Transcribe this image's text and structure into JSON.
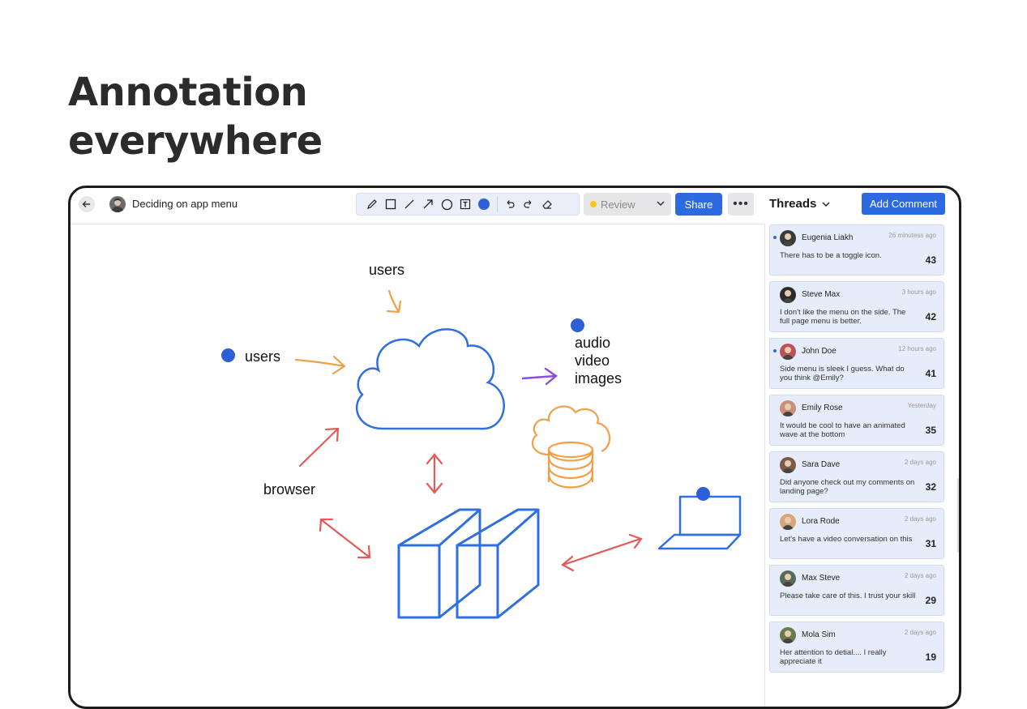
{
  "hero": {
    "line1": "Annotation",
    "line2": "everywhere"
  },
  "document": {
    "title": "Deciding on app menu"
  },
  "toolbar": {
    "tools": [
      "pencil-icon",
      "square-icon",
      "line-icon",
      "arrow-icon",
      "circle-icon",
      "text-icon"
    ],
    "active_color": "#2d5fd8"
  },
  "status": {
    "value": "Review",
    "color": "#f5c518"
  },
  "actions": {
    "share_label": "Share",
    "more_label": "•••"
  },
  "threads": {
    "header": "Threads",
    "add_comment_label": "Add Comment",
    "items": [
      {
        "name": "Eugenia Liakh",
        "time": "26 minutess ago",
        "message": "There has to be a toggle icon.",
        "count": "43",
        "unread": true,
        "avatar": "#3a3a3a"
      },
      {
        "name": "Steve Max",
        "time": "3 hours ago",
        "message": "I don't like the menu on the side. The full page menu is better.",
        "count": "42",
        "unread": false,
        "avatar": "#2b2b2b"
      },
      {
        "name": "John Doe",
        "time": "12 hours ago",
        "message": "Side menu is sleek I guess. What do you think @Emily?",
        "count": "41",
        "unread": true,
        "avatar": "#b8545a"
      },
      {
        "name": "Emily Rose",
        "time": "Yesterday",
        "message": "It would be cool to have an animated wave at the bottom",
        "count": "35",
        "unread": false,
        "avatar": "#c9907a"
      },
      {
        "name": "Sara Dave",
        "time": "2 days ago",
        "message": "Did anyone check out my comments on landing page?",
        "count": "32",
        "unread": false,
        "avatar": "#7a5a4a"
      },
      {
        "name": "Lora Rode",
        "time": "2 days ago",
        "message": "Let's have a video conversation on this",
        "count": "31",
        "unread": false,
        "avatar": "#d6a77a"
      },
      {
        "name": "Max Steve",
        "time": "2 days ago",
        "message": "Please take care of this. I trust your skill",
        "count": "29",
        "unread": false,
        "avatar": "#5a6a5a"
      },
      {
        "name": "Mola Sim",
        "time": "2 days ago",
        "message": "Her attention to detial.... I really appreciate it",
        "count": "19",
        "unread": false,
        "avatar": "#6a7a4a"
      }
    ]
  },
  "sketch": {
    "label_users_top": "users",
    "label_users_left": "users",
    "label_media": [
      "audio",
      "video",
      "images"
    ],
    "label_browser": "browser",
    "colors": {
      "blue": "#2f6fe0",
      "orange": "#f0a04a",
      "red": "#e35a5a",
      "purple": "#8a4de0"
    }
  }
}
